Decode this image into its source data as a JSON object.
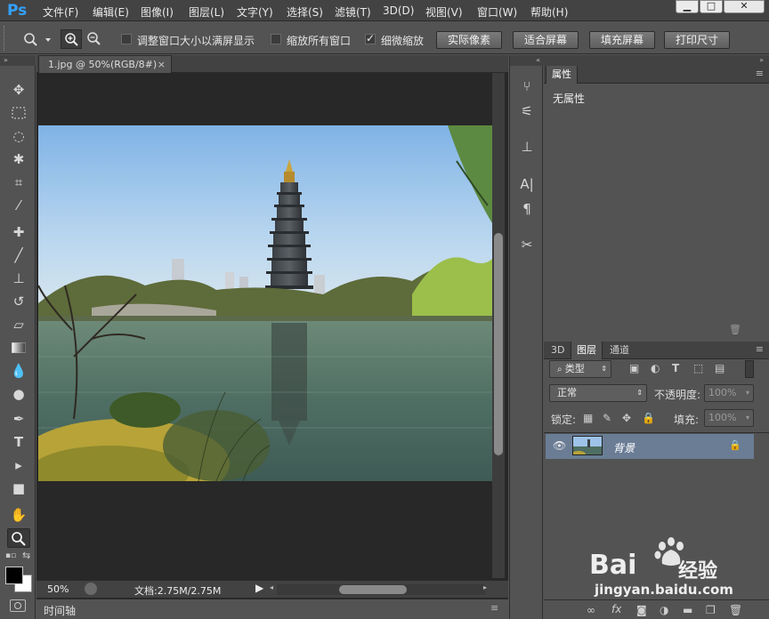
{
  "app": {
    "logo": "Ps",
    "menu": [
      "文件(F)",
      "编辑(E)",
      "图像(I)",
      "图层(L)",
      "文字(Y)",
      "选择(S)",
      "滤镜(T)",
      "3D(D)",
      "视图(V)",
      "窗口(W)",
      "帮助(H)"
    ],
    "window_buttons": [
      "▁",
      "□",
      "✕"
    ]
  },
  "options_bar": {
    "resize_windows_label": "调整窗口大小以满屏显示",
    "zoom_all_label": "缩放所有窗口",
    "scrubby_zoom_label": "细微缩放",
    "scrubby_zoom_checked": true,
    "resize_windows_checked": false,
    "zoom_all_checked": false,
    "btn_actual_pixels": "实际像素",
    "btn_fit_screen": "适合屏幕",
    "btn_fill_screen": "填充屏幕",
    "btn_print_size": "打印尺寸"
  },
  "document": {
    "tab_title": "1.jpg @ 50%(RGB/8#)",
    "tab_close": "×",
    "zoom": "50%",
    "doc_info": "文档:2.75M/2.75M",
    "timeline_label": "时间轴"
  },
  "properties_panel": {
    "tab": "属性",
    "content": "无属性"
  },
  "layers_panel": {
    "tabs": [
      "3D",
      "图层",
      "通道"
    ],
    "active_tab": 1,
    "filter_kind": "类型",
    "blend_mode": "正常",
    "opacity_label": "不透明度:",
    "opacity_value": "100%",
    "lock_label": "锁定:",
    "fill_label": "填充:",
    "fill_value": "100%",
    "layers": [
      {
        "name": "背景",
        "visible": true,
        "locked": true
      }
    ]
  },
  "watermark": {
    "brand": "Bai",
    "brand_suffix": "经验",
    "url": "jingyan.baidu.com"
  }
}
